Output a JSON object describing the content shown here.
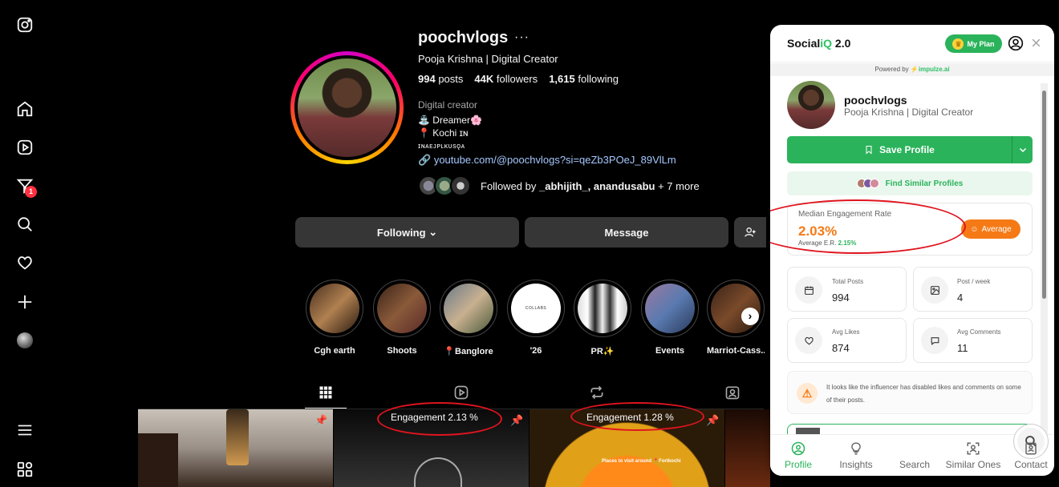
{
  "profile": {
    "username": "poochvlogs",
    "more_label": "···",
    "full_name": "Pooja Krishna | Digital Creator",
    "posts_count": "994",
    "posts_label": "posts",
    "followers_count": "44K",
    "followers_label": "followers",
    "following_count": "1,615",
    "following_label": "following",
    "category": "Digital creator",
    "bio_line1": "⛲ Dreamer🌸",
    "bio_line2": "📍 Kochi ɪɴ",
    "bio_line3": "ɪɴᴀᴇᴊᴘʟᴋᴜsǫᴀ",
    "link": "youtube.com/@poochvlogs?si=qeZb3POeJ_89VlLm",
    "followed_by_prefix": "Followed by ",
    "followed_by_names": "_abhijith_, anandusabu",
    "followed_by_more": " + 7 more"
  },
  "actions": {
    "following_label": "Following",
    "message_label": "Message"
  },
  "rail": {
    "notification_count": "1"
  },
  "highlights": [
    {
      "label": "Cgh earth"
    },
    {
      "label": "Shoots"
    },
    {
      "label": "📍Banglore"
    },
    {
      "label": "'26",
      "inner_text": "COLLABS"
    },
    {
      "label": "PR✨"
    },
    {
      "label": "Events"
    },
    {
      "label": "Marriot-Cass..."
    }
  ],
  "posts": [
    {
      "engagement": "Engagement 2.13 %"
    },
    {
      "engagement": "Engagement 1.28 %",
      "overlay_text": "Places to visit around 📍Fortkochi"
    }
  ],
  "panel": {
    "brand_prefix": "Social",
    "brand_iq": "iQ",
    "brand_version": " 2.0",
    "my_plan": "My Plan",
    "powered_prefix": "Powered by ",
    "powered_brand": "impulze.ai",
    "username": "poochvlogs",
    "full_name": "Pooja Krishna | Digital Creator",
    "save_profile": "Save Profile",
    "find_similar": "Find Similar Profiles",
    "median_er_label": "Median Engagement Rate",
    "median_er_value": "2.03%",
    "average_er_prefix": "Average E.R. ",
    "average_er_value": "2.15%",
    "er_badge": "Average",
    "stats": [
      {
        "label": "Total Posts",
        "value": "994",
        "icon": "calendar-icon"
      },
      {
        "label": "Post / week",
        "value": "4",
        "icon": "image-icon"
      },
      {
        "label": "Avg Likes",
        "value": "874",
        "icon": "heart-icon"
      },
      {
        "label": "Avg Comments",
        "value": "11",
        "icon": "comment-icon"
      }
    ],
    "warning": "It looks like the influencer has disabled likes and comments on some of their posts.",
    "nav": [
      {
        "label": "Profile"
      },
      {
        "label": "Insights"
      },
      {
        "label": "Search"
      },
      {
        "label": "Similar Ones"
      },
      {
        "label": "Contact"
      }
    ]
  },
  "colors": {
    "accent_green": "#2bb35b",
    "accent_orange": "#f57a16",
    "annotation_red": "#e0141e"
  }
}
